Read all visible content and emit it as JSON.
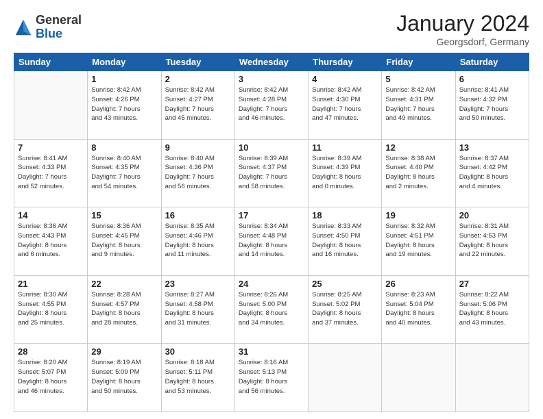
{
  "logo": {
    "general": "General",
    "blue": "Blue"
  },
  "title": "January 2024",
  "location": "Georgsdorf, Germany",
  "weekdays": [
    "Sunday",
    "Monday",
    "Tuesday",
    "Wednesday",
    "Thursday",
    "Friday",
    "Saturday"
  ],
  "weeks": [
    [
      {
        "day": "",
        "info": ""
      },
      {
        "day": "1",
        "info": "Sunrise: 8:42 AM\nSunset: 4:26 PM\nDaylight: 7 hours\nand 43 minutes."
      },
      {
        "day": "2",
        "info": "Sunrise: 8:42 AM\nSunset: 4:27 PM\nDaylight: 7 hours\nand 45 minutes."
      },
      {
        "day": "3",
        "info": "Sunrise: 8:42 AM\nSunset: 4:28 PM\nDaylight: 7 hours\nand 46 minutes."
      },
      {
        "day": "4",
        "info": "Sunrise: 8:42 AM\nSunset: 4:30 PM\nDaylight: 7 hours\nand 47 minutes."
      },
      {
        "day": "5",
        "info": "Sunrise: 8:42 AM\nSunset: 4:31 PM\nDaylight: 7 hours\nand 49 minutes."
      },
      {
        "day": "6",
        "info": "Sunrise: 8:41 AM\nSunset: 4:32 PM\nDaylight: 7 hours\nand 50 minutes."
      }
    ],
    [
      {
        "day": "7",
        "info": "Sunrise: 8:41 AM\nSunset: 4:33 PM\nDaylight: 7 hours\nand 52 minutes."
      },
      {
        "day": "8",
        "info": "Sunrise: 8:40 AM\nSunset: 4:35 PM\nDaylight: 7 hours\nand 54 minutes."
      },
      {
        "day": "9",
        "info": "Sunrise: 8:40 AM\nSunset: 4:36 PM\nDaylight: 7 hours\nand 56 minutes."
      },
      {
        "day": "10",
        "info": "Sunrise: 8:39 AM\nSunset: 4:37 PM\nDaylight: 7 hours\nand 58 minutes."
      },
      {
        "day": "11",
        "info": "Sunrise: 8:39 AM\nSunset: 4:39 PM\nDaylight: 8 hours\nand 0 minutes."
      },
      {
        "day": "12",
        "info": "Sunrise: 8:38 AM\nSunset: 4:40 PM\nDaylight: 8 hours\nand 2 minutes."
      },
      {
        "day": "13",
        "info": "Sunrise: 8:37 AM\nSunset: 4:42 PM\nDaylight: 8 hours\nand 4 minutes."
      }
    ],
    [
      {
        "day": "14",
        "info": "Sunrise: 8:36 AM\nSunset: 4:43 PM\nDaylight: 8 hours\nand 6 minutes."
      },
      {
        "day": "15",
        "info": "Sunrise: 8:36 AM\nSunset: 4:45 PM\nDaylight: 8 hours\nand 9 minutes."
      },
      {
        "day": "16",
        "info": "Sunrise: 8:35 AM\nSunset: 4:46 PM\nDaylight: 8 hours\nand 11 minutes."
      },
      {
        "day": "17",
        "info": "Sunrise: 8:34 AM\nSunset: 4:48 PM\nDaylight: 8 hours\nand 14 minutes."
      },
      {
        "day": "18",
        "info": "Sunrise: 8:33 AM\nSunset: 4:50 PM\nDaylight: 8 hours\nand 16 minutes."
      },
      {
        "day": "19",
        "info": "Sunrise: 8:32 AM\nSunset: 4:51 PM\nDaylight: 8 hours\nand 19 minutes."
      },
      {
        "day": "20",
        "info": "Sunrise: 8:31 AM\nSunset: 4:53 PM\nDaylight: 8 hours\nand 22 minutes."
      }
    ],
    [
      {
        "day": "21",
        "info": "Sunrise: 8:30 AM\nSunset: 4:55 PM\nDaylight: 8 hours\nand 25 minutes."
      },
      {
        "day": "22",
        "info": "Sunrise: 8:28 AM\nSunset: 4:57 PM\nDaylight: 8 hours\nand 28 minutes."
      },
      {
        "day": "23",
        "info": "Sunrise: 8:27 AM\nSunset: 4:58 PM\nDaylight: 8 hours\nand 31 minutes."
      },
      {
        "day": "24",
        "info": "Sunrise: 8:26 AM\nSunset: 5:00 PM\nDaylight: 8 hours\nand 34 minutes."
      },
      {
        "day": "25",
        "info": "Sunrise: 8:25 AM\nSunset: 5:02 PM\nDaylight: 8 hours\nand 37 minutes."
      },
      {
        "day": "26",
        "info": "Sunrise: 8:23 AM\nSunset: 5:04 PM\nDaylight: 8 hours\nand 40 minutes."
      },
      {
        "day": "27",
        "info": "Sunrise: 8:22 AM\nSunset: 5:06 PM\nDaylight: 8 hours\nand 43 minutes."
      }
    ],
    [
      {
        "day": "28",
        "info": "Sunrise: 8:20 AM\nSunset: 5:07 PM\nDaylight: 8 hours\nand 46 minutes."
      },
      {
        "day": "29",
        "info": "Sunrise: 8:19 AM\nSunset: 5:09 PM\nDaylight: 8 hours\nand 50 minutes."
      },
      {
        "day": "30",
        "info": "Sunrise: 8:18 AM\nSunset: 5:11 PM\nDaylight: 8 hours\nand 53 minutes."
      },
      {
        "day": "31",
        "info": "Sunrise: 8:16 AM\nSunset: 5:13 PM\nDaylight: 8 hours\nand 56 minutes."
      },
      {
        "day": "",
        "info": ""
      },
      {
        "day": "",
        "info": ""
      },
      {
        "day": "",
        "info": ""
      }
    ]
  ]
}
